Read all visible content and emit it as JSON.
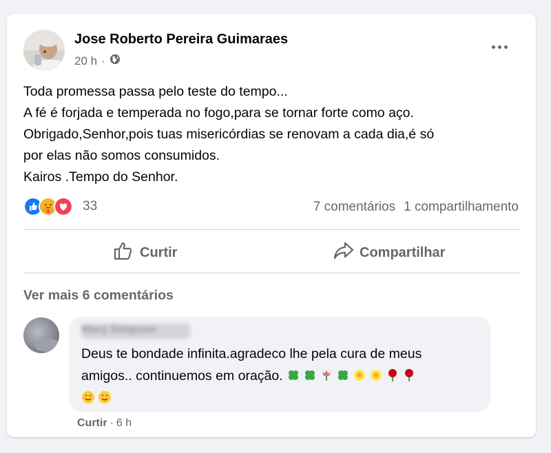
{
  "post": {
    "author": "Jose Roberto Pereira Guimaraes",
    "time": "20 h",
    "separator": "·",
    "lines": [
      "Toda promessa passa pelo teste do tempo...",
      "A fé é forjada e temperada no fogo,para se tornar forte como aço.",
      "Obrigado,Senhor,pois tuas misericórdias se renovam a cada dia,é só",
      "por elas não somos consumidos.",
      "Kairos .Tempo do Senhor."
    ],
    "reaction_count": "33",
    "comments_count": "7 comentários",
    "shares_count": "1 compartilhamento"
  },
  "actions": {
    "like": "Curtir",
    "share": "Compartilhar"
  },
  "comments": {
    "see_more": "Ver mais 6 comentários",
    "first": {
      "author_blurred": "Mary Simpson",
      "line1": "Deus te bondade infinita.agradeco lhe pela cura de meus",
      "line2": "amigos.. continuemos em oração.",
      "like_label": "Curtir",
      "separator": "·",
      "time": "6 h"
    }
  },
  "colors": {
    "like_blue": "#1877f2",
    "love_red": "#f33e58",
    "care_yellow": "#f7b125",
    "muted_text": "#65676b"
  },
  "icons": [
    "globe-icon",
    "like-reaction-icon",
    "care-reaction-icon",
    "love-reaction-icon",
    "thumbs-up-icon",
    "share-arrow-icon",
    "more-options-icon"
  ]
}
